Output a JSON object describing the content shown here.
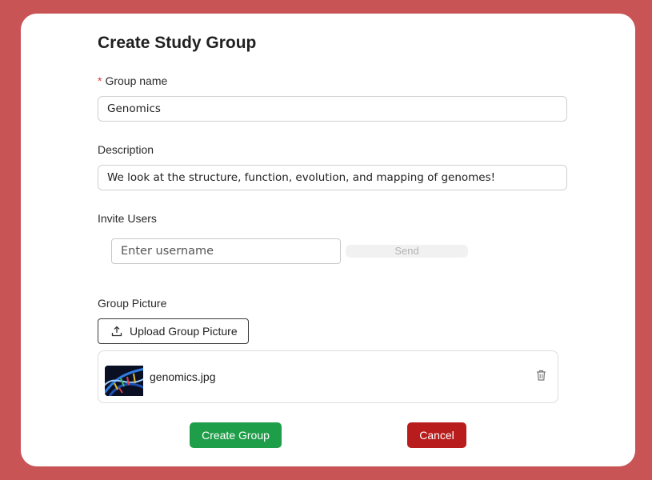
{
  "form": {
    "title": "Create Study Group",
    "group_name": {
      "required_marker": "*",
      "label": "Group name",
      "value": "Genomics"
    },
    "description": {
      "label": "Description",
      "value": "We look at the structure, function, evolution, and mapping of genomes!"
    },
    "invite": {
      "label": "Invite Users",
      "placeholder": "Enter username",
      "send_label": "Send"
    },
    "picture": {
      "label": "Group Picture",
      "upload_label": "Upload Group Picture",
      "file_name": "genomics.jpg"
    },
    "actions": {
      "create_label": "Create Group",
      "cancel_label": "Cancel"
    }
  },
  "icons": {
    "upload": "upload-icon",
    "delete": "trash-icon",
    "thumbnail": "dna-image"
  },
  "colors": {
    "background": "#c85456",
    "create": "#1f9e4a",
    "cancel": "#b81c1c",
    "required": "#d9363e"
  }
}
